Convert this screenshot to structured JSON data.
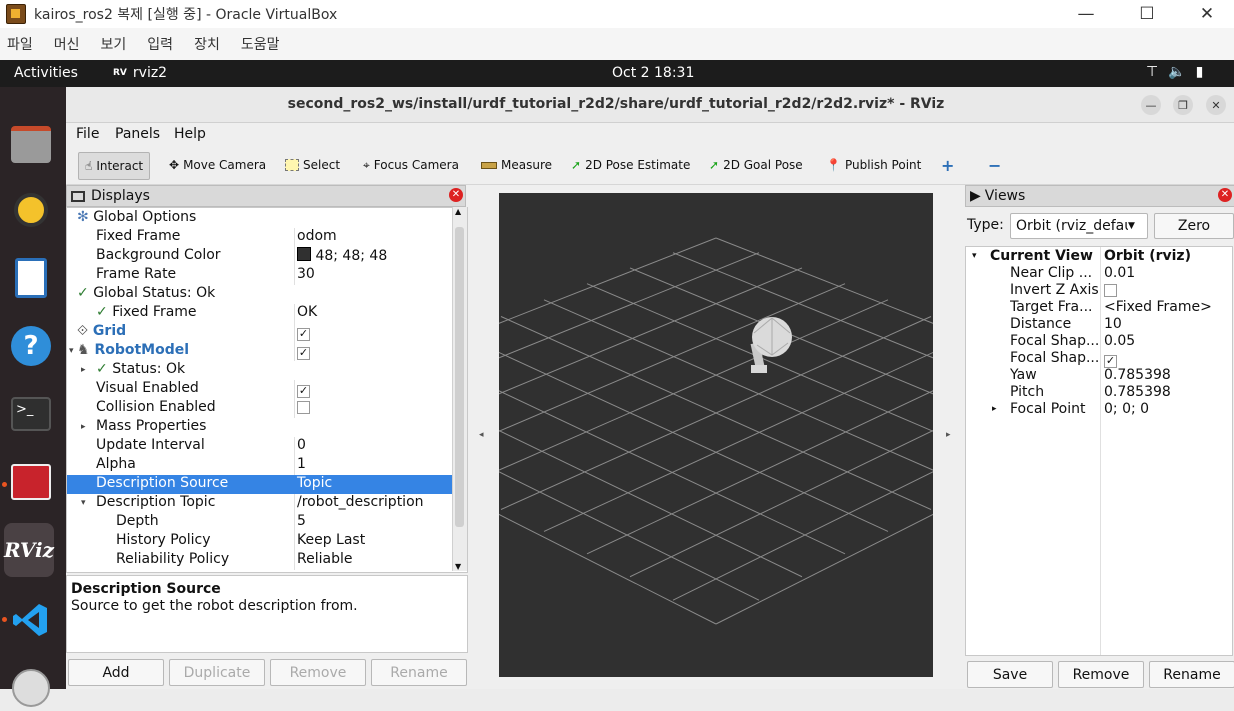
{
  "vbox": {
    "title": "kairos_ros2 복제 [실행 중] - Oracle VirtualBox",
    "menu": [
      "파일",
      "머신",
      "보기",
      "입력",
      "장치",
      "도움말"
    ],
    "ctl_min": "—",
    "ctl_max": "☐",
    "ctl_close": "✕"
  },
  "gnome": {
    "activities": "Activities",
    "app": "rviz2",
    "app_badge": "RV",
    "clock": "Oct 2  18:31"
  },
  "rviz": {
    "title": "second_ros2_ws/install/urdf_tutorial_r2d2/share/urdf_tutorial_r2d2/r2d2.rviz* - RViz",
    "menu": [
      "File",
      "Panels",
      "Help"
    ],
    "tools": [
      "Interact",
      "Move Camera",
      "Select",
      "Focus Camera",
      "Measure",
      "2D Pose Estimate",
      "2D Goal Pose",
      "Publish Point"
    ],
    "displays_title": "Displays",
    "views_title": "Views",
    "rows": [
      {
        "name": "Global Options",
        "value": ""
      },
      {
        "name": "Fixed Frame",
        "value": "odom"
      },
      {
        "name": "Background Color",
        "value": "48; 48; 48"
      },
      {
        "name": "Frame Rate",
        "value": "30"
      },
      {
        "name": "Global Status: Ok",
        "value": ""
      },
      {
        "name": "Fixed Frame",
        "value": "OK"
      },
      {
        "name": "Grid",
        "value": ""
      },
      {
        "name": "RobotModel",
        "value": ""
      },
      {
        "name": "Status: Ok",
        "value": ""
      },
      {
        "name": "Visual Enabled",
        "value": ""
      },
      {
        "name": "Collision Enabled",
        "value": ""
      },
      {
        "name": "Mass Properties",
        "value": ""
      },
      {
        "name": "Update Interval",
        "value": "0"
      },
      {
        "name": "Alpha",
        "value": "1"
      },
      {
        "name": "Description Source",
        "value": "Topic"
      },
      {
        "name": "Description Topic",
        "value": "/robot_description"
      },
      {
        "name": "Depth",
        "value": "5"
      },
      {
        "name": "History Policy",
        "value": "Keep Last"
      },
      {
        "name": "Reliability Policy",
        "value": "Reliable"
      }
    ],
    "desc_title": "Description Source",
    "desc_text": "Source to get the robot description from.",
    "buttons": [
      "Add",
      "Duplicate",
      "Remove",
      "Rename"
    ],
    "views": {
      "type_label": "Type:",
      "type_value": "Orbit (rviz_defau",
      "zero": "Zero",
      "current_view": "Current View",
      "current_value": "Orbit (rviz)",
      "props": [
        {
          "name": "Near Clip ...",
          "value": "0.01"
        },
        {
          "name": "Invert Z Axis",
          "value": ""
        },
        {
          "name": "Target Fra...",
          "value": "<Fixed Frame>"
        },
        {
          "name": "Distance",
          "value": "10"
        },
        {
          "name": "Focal Shap...",
          "value": "0.05"
        },
        {
          "name": "Focal Shap...",
          "value": ""
        },
        {
          "name": "Yaw",
          "value": "0.785398"
        },
        {
          "name": "Pitch",
          "value": "0.785398"
        },
        {
          "name": "Focal Point",
          "value": "0; 0; 0"
        }
      ],
      "buttons": [
        "Save",
        "Remove",
        "Rename"
      ]
    }
  },
  "colors": {
    "background_swatch": "#303030",
    "selection": "#3584e4",
    "accent": "#e95420"
  }
}
